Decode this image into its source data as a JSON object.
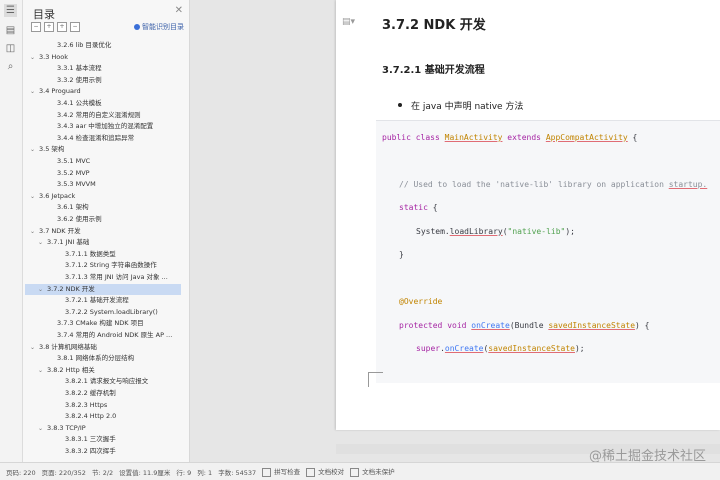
{
  "toc": {
    "title": "目录",
    "smart_label": "智能识别目录",
    "items": [
      {
        "label": "3.2.6 lib 目录优化",
        "level": 2,
        "caret": ""
      },
      {
        "label": "3.3 Hook",
        "level": 0,
        "caret": "⌄"
      },
      {
        "label": "3.3.1 基本流程",
        "level": 2,
        "caret": ""
      },
      {
        "label": "3.3.2 使用示例",
        "level": 2,
        "caret": ""
      },
      {
        "label": "3.4 Proguard",
        "level": 0,
        "caret": "⌄"
      },
      {
        "label": "3.4.1 公共模板",
        "level": 2,
        "caret": ""
      },
      {
        "label": "3.4.2 常用的自定义混淆规则",
        "level": 2,
        "caret": ""
      },
      {
        "label": "3.4.3 aar 中增加独立的混淆配置",
        "level": 2,
        "caret": ""
      },
      {
        "label": "3.4.4 检查混淆和追踪异常",
        "level": 2,
        "caret": ""
      },
      {
        "label": "3.5 架构",
        "level": 0,
        "caret": "⌄"
      },
      {
        "label": "3.5.1 MVC",
        "level": 2,
        "caret": ""
      },
      {
        "label": "3.5.2 MVP",
        "level": 2,
        "caret": ""
      },
      {
        "label": "3.5.3 MVVM",
        "level": 2,
        "caret": ""
      },
      {
        "label": "3.6 Jetpack",
        "level": 0,
        "caret": "⌄"
      },
      {
        "label": "3.6.1 架构",
        "level": 2,
        "caret": ""
      },
      {
        "label": "3.6.2 使用示例",
        "level": 2,
        "caret": ""
      },
      {
        "label": "3.7 NDK 开发",
        "level": 0,
        "caret": "⌄"
      },
      {
        "label": "3.7.1 JNI 基础",
        "level": 1,
        "caret": "⌄"
      },
      {
        "label": "3.7.1.1 数据类型",
        "level": 3,
        "caret": ""
      },
      {
        "label": "3.7.1.2 String 字符串函数操作",
        "level": 3,
        "caret": ""
      },
      {
        "label": "3.7.1.3 常用 JNI 访问 Java 对象 ...",
        "level": 3,
        "caret": ""
      },
      {
        "label": "3.7.2 NDK 开发",
        "level": 1,
        "caret": "⌄",
        "selected": true
      },
      {
        "label": "3.7.2.1 基础开发流程",
        "level": 3,
        "caret": ""
      },
      {
        "label": "3.7.2.2 System.loadLibrary()",
        "level": 3,
        "caret": ""
      },
      {
        "label": "3.7.3 CMake 构建 NDK 项目",
        "level": 2,
        "caret": ""
      },
      {
        "label": "3.7.4 常用的 Android NDK 原生 AP ...",
        "level": 2,
        "caret": ""
      },
      {
        "label": "3.8 计算机网络基础",
        "level": 0,
        "caret": "⌄"
      },
      {
        "label": "3.8.1 网络体系的分层结构",
        "level": 2,
        "caret": ""
      },
      {
        "label": "3.8.2 Http 相关",
        "level": 1,
        "caret": "⌄"
      },
      {
        "label": "3.8.2.1 请求报文与响应报文",
        "level": 3,
        "caret": ""
      },
      {
        "label": "3.8.2.2 缓存机制",
        "level": 3,
        "caret": ""
      },
      {
        "label": "3.8.2.3 Https",
        "level": 3,
        "caret": ""
      },
      {
        "label": "3.8.2.4 Http 2.0",
        "level": 3,
        "caret": ""
      },
      {
        "label": "3.8.3 TCP/IP",
        "level": 1,
        "caret": "⌄"
      },
      {
        "label": "3.8.3.1 三次握手",
        "level": 3,
        "caret": ""
      },
      {
        "label": "3.8.3.2 四次挥手",
        "level": 3,
        "caret": ""
      }
    ]
  },
  "doc": {
    "heading": "3.7.2 NDK 开发",
    "subheading": "3.7.2.1 基础开发流程",
    "bullet": "在 java 中声明 native 方法",
    "code": {
      "l1_kw1": "public",
      "l1_kw2": "class",
      "l1_cls": "MainActivity",
      "l1_kw3": "extends",
      "l1_sup": "AppCompatActivity",
      "l1_end": " {",
      "l2_comment_a": "// Used to load the 'native-lib' library on application ",
      "l2_comment_b": "startup.",
      "l3_kw": "static",
      "l3_end": " {",
      "l4_pre": "System.",
      "l4_fn": "loadLibrary",
      "l4_open": "(",
      "l4_str": "\"native-lib\"",
      "l4_close": ");",
      "l5": "}",
      "l6_an": "@Override",
      "l7_kw1": "protected",
      "l7_kw2": "void",
      "l7_fn": "onCreate",
      "l7_mid": "(Bundle ",
      "l7_param": "savedInstanceState",
      "l7_end": ") {",
      "l8_kw": "super",
      "l8_dot": ".",
      "l8_fn": "onCreate",
      "l8_open": "(",
      "l8_param": "savedInstanceState",
      "l8_close": ");"
    }
  },
  "watermark": "@稀土掘金技术社区",
  "status": {
    "page": "页码: 220",
    "pages": "页面: 220/352",
    "section": "节: 2/2",
    "setting": "设置值: 11.9厘米",
    "row": "行: 9",
    "col": "列: 1",
    "words": "字数: 54537",
    "spell": "拼写检查",
    "proof": "文档校对",
    "protect": "文档未保护"
  }
}
